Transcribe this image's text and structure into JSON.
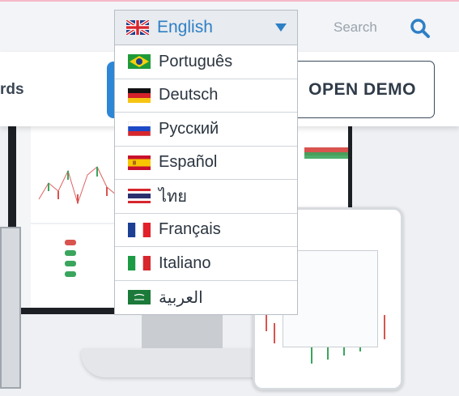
{
  "header": {
    "search_label": "Search"
  },
  "nav": {
    "partial_label": "rds",
    "demo_button": "OPEN DEMO"
  },
  "language_dropdown": {
    "selected": {
      "label": "English",
      "flag": "uk-flag-icon"
    },
    "options": [
      {
        "label": "Português",
        "flag": "brazil-flag-icon"
      },
      {
        "label": "Deutsch",
        "flag": "germany-flag-icon"
      },
      {
        "label": "Русский",
        "flag": "russia-flag-icon"
      },
      {
        "label": "Español",
        "flag": "spain-flag-icon"
      },
      {
        "label": "ไทย",
        "flag": "thailand-flag-icon"
      },
      {
        "label": "Français",
        "flag": "france-flag-icon"
      },
      {
        "label": "Italiano",
        "flag": "italy-flag-icon"
      },
      {
        "label": "العربية",
        "flag": "saudi-flag-icon"
      }
    ]
  },
  "colors": {
    "accent_blue": "#2d7fc6",
    "button_blue": "#2e86d6",
    "text_dark": "#2f3b48"
  }
}
